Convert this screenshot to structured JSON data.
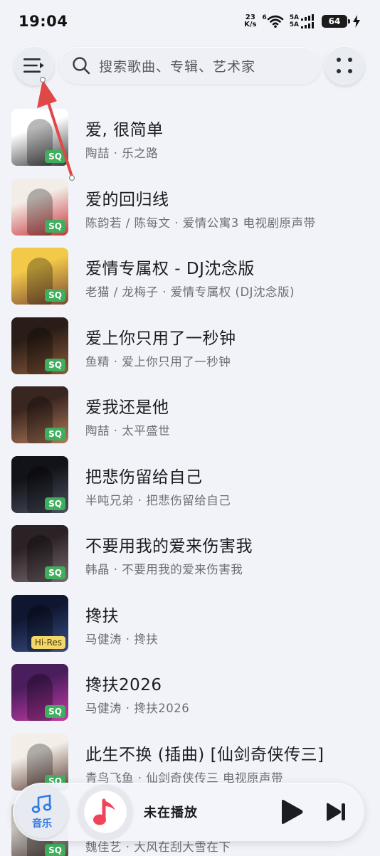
{
  "status": {
    "time": "19:04",
    "net_speed_value": "23",
    "net_speed_unit": "K/s",
    "sim1": "5A",
    "sim2": "5A",
    "wifi_label": "6",
    "battery": "64"
  },
  "search": {
    "placeholder": "搜索歌曲、专辑、艺术家"
  },
  "songs": [
    {
      "title": "爱, 很简单",
      "subtitle": "陶喆 · 乐之路",
      "badge": "SQ",
      "cover_colors": [
        "#ffffff",
        "#3b3b3b"
      ]
    },
    {
      "title": "爱的回归线",
      "subtitle": "陈韵若 / 陈每文 · 爱情公寓3 电视剧原声带",
      "badge": "SQ",
      "cover_colors": [
        "#f2ede6",
        "#c8353a"
      ]
    },
    {
      "title": "爱情专属权 - DJ沈念版",
      "subtitle": "老猫 / 龙梅子 · 爱情专属权 (DJ沈念版)",
      "badge": "SQ",
      "cover_colors": [
        "#f3c94a",
        "#7a4a34"
      ]
    },
    {
      "title": "爱上你只用了一秒钟",
      "subtitle": "鱼精 · 爱上你只用了一秒钟",
      "badge": "SQ",
      "cover_colors": [
        "#2a1d17",
        "#8b5a3b"
      ]
    },
    {
      "title": "爱我还是他",
      "subtitle": "陶喆 · 太平盛世",
      "badge": "SQ",
      "cover_colors": [
        "#3a2620",
        "#b27a5a"
      ]
    },
    {
      "title": "把悲伤留给自己",
      "subtitle": "半吨兄弟 · 把悲伤留给自己",
      "badge": "SQ",
      "cover_colors": [
        "#121318",
        "#4a5060"
      ]
    },
    {
      "title": "不要用我的爱来伤害我",
      "subtitle": "韩晶 · 不要用我的爱来伤害我",
      "badge": "SQ",
      "cover_colors": [
        "#2b2226",
        "#7a6a70"
      ]
    },
    {
      "title": "搀扶",
      "subtitle": "马健涛 · 搀扶",
      "badge": "Hi-Res",
      "cover_colors": [
        "#0e1630",
        "#3b4f86"
      ]
    },
    {
      "title": "搀扶2026",
      "subtitle": "马健涛 · 搀扶2026",
      "badge": "SQ",
      "cover_colors": [
        "#4a1d5c",
        "#c53ca8"
      ]
    },
    {
      "title": "此生不换 (插曲) [仙剑奇侠传三]",
      "subtitle": "青鸟飞鱼 · 仙剑奇侠传三 电视原声带",
      "badge": "SQ",
      "cover_colors": [
        "#f3efe8",
        "#5a3a32"
      ]
    },
    {
      "title": "",
      "subtitle": "魏佳艺 · 大风在刮大雪在下",
      "badge": "SQ",
      "cover_colors": [
        "#c9c5bf",
        "#4a3a34"
      ]
    }
  ],
  "player": {
    "tab_label": "音乐",
    "now_playing": "未在播放"
  },
  "colors": {
    "accent": "#2d7be5",
    "sq_badge": "#3fae5d",
    "hires_badge": "#f3d768",
    "annotation_arrow": "#e04848"
  }
}
